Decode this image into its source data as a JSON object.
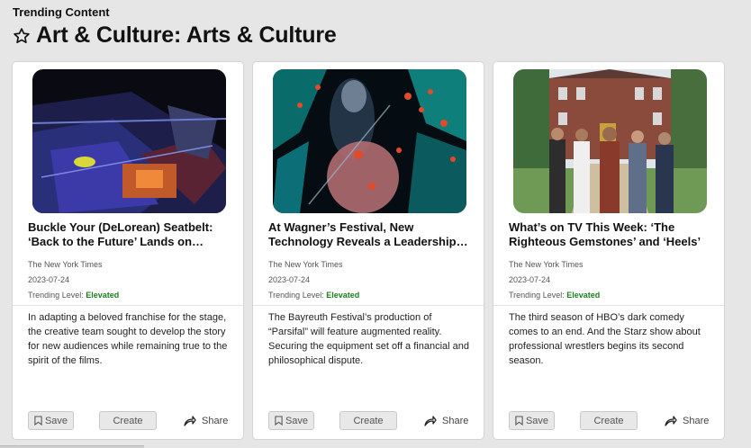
{
  "header": {
    "section_label": "Trending Content",
    "title": "Art & Culture: Arts & Culture",
    "icon": "star-outline-icon"
  },
  "colors": {
    "trend_elevated": "#1a7f1a",
    "card_background": "#ffffff",
    "page_background": "#e6e6e6"
  },
  "cards": [
    {
      "title": "Buckle Your (DeLorean) Seatbelt: ‘Back to the Future’ Lands on Broadway",
      "source": "The New York Times",
      "date": "2023-07-24",
      "trend_label": "Trending Level:",
      "trend_value": "Elevated",
      "description": "In adapting a beloved franchise for the stage, the creative team sought to develop the story for new audiences while remaining true to the spirit of the films.",
      "save_label": "Save",
      "create_label": "Create",
      "share_label": "Share"
    },
    {
      "title": "At Wagner’s Festival, New Technology Reveals a Leadership Rift",
      "source": "The New York Times",
      "date": "2023-07-24",
      "trend_label": "Trending Level:",
      "trend_value": "Elevated",
      "description": "The Bayreuth Festival’s production of “Parsifal” will feature augmented reality. Securing the equipment set off a financial and philosophical dispute.",
      "save_label": "Save",
      "create_label": "Create",
      "share_label": "Share"
    },
    {
      "title": "What’s on TV This Week: ‘The Righteous Gemstones’ and ‘Heels’",
      "source": "The New York Times",
      "date": "2023-07-24",
      "trend_label": "Trending Level:",
      "trend_value": "Elevated",
      "description": "The third season of HBO’s dark comedy comes to an end. And the Starz show about professional wrestlers begins its second season.",
      "save_label": "Save",
      "create_label": "Create",
      "share_label": "Share"
    }
  ]
}
